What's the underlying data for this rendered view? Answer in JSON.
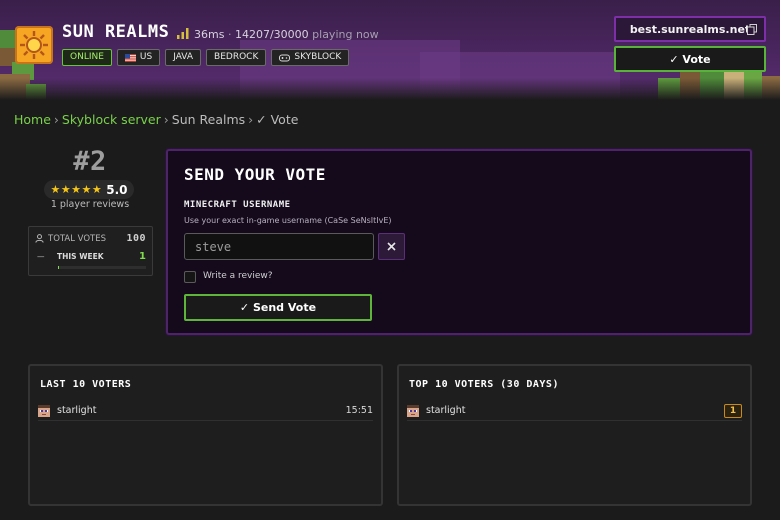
{
  "server": {
    "title": "SUN REALMS",
    "ping": "36ms",
    "players": "14207/30000",
    "players_suffix": "playing now",
    "tags": [
      {
        "label": "ONLINE"
      },
      {
        "label": "US",
        "icon": "us-flag-icon"
      },
      {
        "label": "JAVA"
      },
      {
        "label": "BEDROCK"
      },
      {
        "label": "SKYBLOCK",
        "icon": "gamepad-icon"
      }
    ],
    "ip": "best.sunrealms.net",
    "vote_button": "✓ Vote"
  },
  "breadcrumb": {
    "home": "Home",
    "category": "Skyblock server",
    "server": "Sun Realms",
    "current": "✓ Vote",
    "separator": "›"
  },
  "rank": {
    "position": "#2",
    "stars": "★★★★★",
    "rating": "5.0",
    "reviews": "1 player reviews",
    "total_votes_label": "TOTAL VOTES",
    "total_votes": "100",
    "this_week_label": "THIS WEEK",
    "this_week": "1",
    "this_week_dash": "—",
    "this_week_fraction": 0.01
  },
  "vote_form": {
    "title": "SEND YOUR VOTE",
    "username_label": "MINECRAFT USERNAME",
    "username_help": "Use your exact in-game username (CaSe SeNsItIvE)",
    "username_value": "steve",
    "review_label": "Write a review?",
    "submit_label": "✓ Send Vote"
  },
  "last_voters": {
    "title": "LAST 10 VOTERS",
    "rows": [
      {
        "name": "starlight",
        "time": "15:51"
      }
    ]
  },
  "top_voters": {
    "title": "TOP 10 VOTERS (30 DAYS)",
    "rows": [
      {
        "name": "starlight",
        "count": "1"
      }
    ]
  },
  "colors": {
    "accent_green": "#79d24a",
    "accent_purple": "#7d2fa8",
    "star_gold": "#f5c518"
  }
}
